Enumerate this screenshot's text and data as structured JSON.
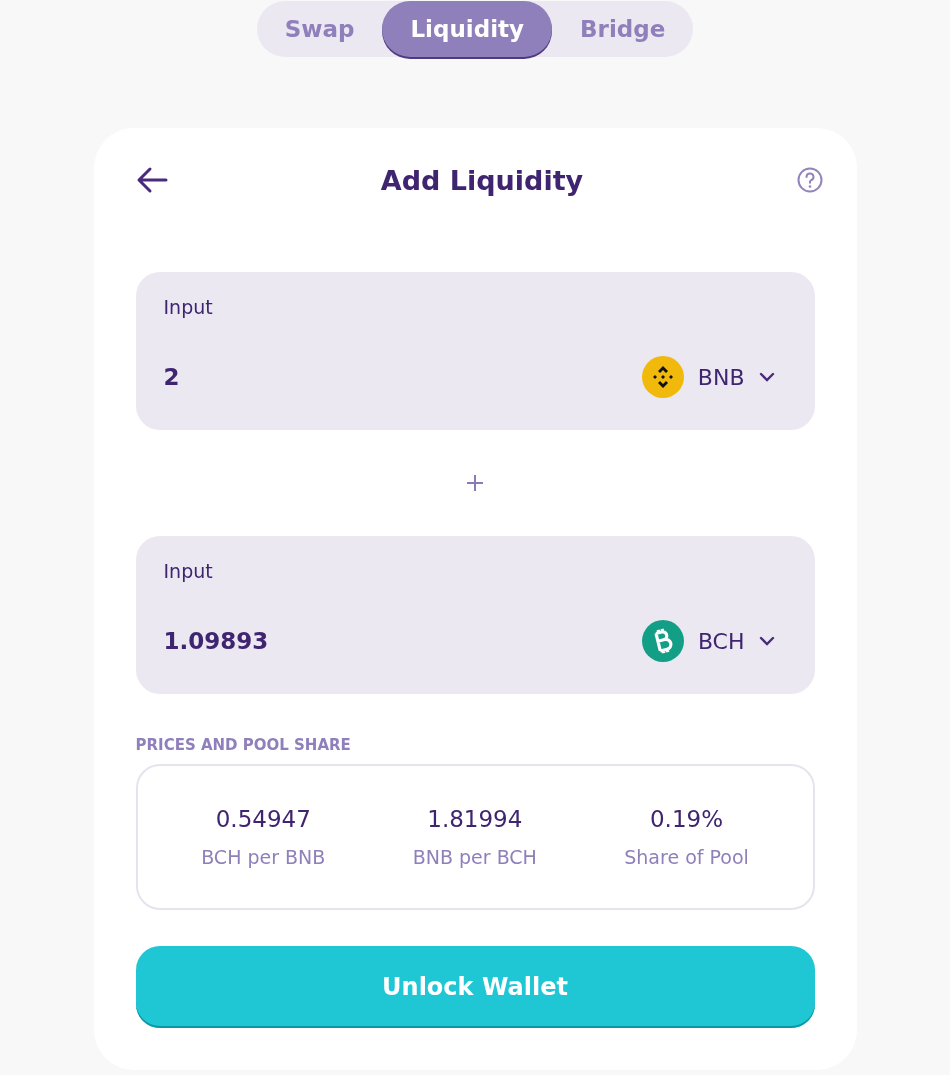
{
  "tabs": [
    {
      "label": "Swap",
      "selected": false
    },
    {
      "label": "Liquidity",
      "selected": true
    },
    {
      "label": "Bridge",
      "selected": false
    }
  ],
  "card": {
    "title": "Add Liquidity",
    "inputs": [
      {
        "label": "Input",
        "value": "2",
        "token": "BNB",
        "kind": "bnb"
      },
      {
        "label": "Input",
        "value": "1.09893",
        "token": "BCH",
        "kind": "bch"
      }
    ],
    "prices": {
      "heading": "PRICES AND POOL SHARE",
      "items": [
        {
          "value": "0.54947",
          "label": "BCH per BNB"
        },
        {
          "value": "1.81994",
          "label": "BNB per BCH"
        },
        {
          "value": "0.19%",
          "label": "Share of Pool"
        }
      ]
    },
    "button": "Unlock Wallet"
  }
}
